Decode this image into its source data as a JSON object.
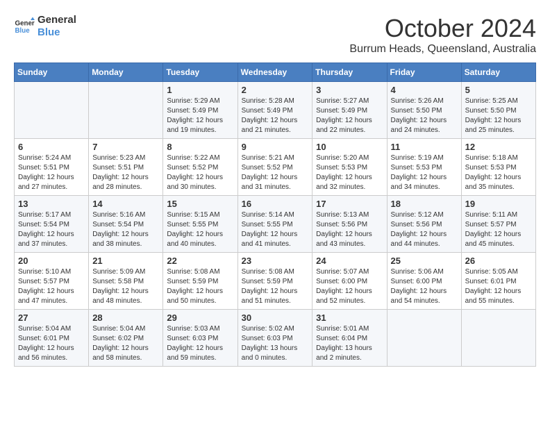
{
  "logo": {
    "line1": "General",
    "line2": "Blue"
  },
  "title": "October 2024",
  "location": "Burrum Heads, Queensland, Australia",
  "weekdays": [
    "Sunday",
    "Monday",
    "Tuesday",
    "Wednesday",
    "Thursday",
    "Friday",
    "Saturday"
  ],
  "weeks": [
    [
      {
        "day": "",
        "sunrise": "",
        "sunset": "",
        "daylight": ""
      },
      {
        "day": "",
        "sunrise": "",
        "sunset": "",
        "daylight": ""
      },
      {
        "day": "1",
        "sunrise": "Sunrise: 5:29 AM",
        "sunset": "Sunset: 5:49 PM",
        "daylight": "Daylight: 12 hours and 19 minutes."
      },
      {
        "day": "2",
        "sunrise": "Sunrise: 5:28 AM",
        "sunset": "Sunset: 5:49 PM",
        "daylight": "Daylight: 12 hours and 21 minutes."
      },
      {
        "day": "3",
        "sunrise": "Sunrise: 5:27 AM",
        "sunset": "Sunset: 5:49 PM",
        "daylight": "Daylight: 12 hours and 22 minutes."
      },
      {
        "day": "4",
        "sunrise": "Sunrise: 5:26 AM",
        "sunset": "Sunset: 5:50 PM",
        "daylight": "Daylight: 12 hours and 24 minutes."
      },
      {
        "day": "5",
        "sunrise": "Sunrise: 5:25 AM",
        "sunset": "Sunset: 5:50 PM",
        "daylight": "Daylight: 12 hours and 25 minutes."
      }
    ],
    [
      {
        "day": "6",
        "sunrise": "Sunrise: 5:24 AM",
        "sunset": "Sunset: 5:51 PM",
        "daylight": "Daylight: 12 hours and 27 minutes."
      },
      {
        "day": "7",
        "sunrise": "Sunrise: 5:23 AM",
        "sunset": "Sunset: 5:51 PM",
        "daylight": "Daylight: 12 hours and 28 minutes."
      },
      {
        "day": "8",
        "sunrise": "Sunrise: 5:22 AM",
        "sunset": "Sunset: 5:52 PM",
        "daylight": "Daylight: 12 hours and 30 minutes."
      },
      {
        "day": "9",
        "sunrise": "Sunrise: 5:21 AM",
        "sunset": "Sunset: 5:52 PM",
        "daylight": "Daylight: 12 hours and 31 minutes."
      },
      {
        "day": "10",
        "sunrise": "Sunrise: 5:20 AM",
        "sunset": "Sunset: 5:53 PM",
        "daylight": "Daylight: 12 hours and 32 minutes."
      },
      {
        "day": "11",
        "sunrise": "Sunrise: 5:19 AM",
        "sunset": "Sunset: 5:53 PM",
        "daylight": "Daylight: 12 hours and 34 minutes."
      },
      {
        "day": "12",
        "sunrise": "Sunrise: 5:18 AM",
        "sunset": "Sunset: 5:53 PM",
        "daylight": "Daylight: 12 hours and 35 minutes."
      }
    ],
    [
      {
        "day": "13",
        "sunrise": "Sunrise: 5:17 AM",
        "sunset": "Sunset: 5:54 PM",
        "daylight": "Daylight: 12 hours and 37 minutes."
      },
      {
        "day": "14",
        "sunrise": "Sunrise: 5:16 AM",
        "sunset": "Sunset: 5:54 PM",
        "daylight": "Daylight: 12 hours and 38 minutes."
      },
      {
        "day": "15",
        "sunrise": "Sunrise: 5:15 AM",
        "sunset": "Sunset: 5:55 PM",
        "daylight": "Daylight: 12 hours and 40 minutes."
      },
      {
        "day": "16",
        "sunrise": "Sunrise: 5:14 AM",
        "sunset": "Sunset: 5:55 PM",
        "daylight": "Daylight: 12 hours and 41 minutes."
      },
      {
        "day": "17",
        "sunrise": "Sunrise: 5:13 AM",
        "sunset": "Sunset: 5:56 PM",
        "daylight": "Daylight: 12 hours and 43 minutes."
      },
      {
        "day": "18",
        "sunrise": "Sunrise: 5:12 AM",
        "sunset": "Sunset: 5:56 PM",
        "daylight": "Daylight: 12 hours and 44 minutes."
      },
      {
        "day": "19",
        "sunrise": "Sunrise: 5:11 AM",
        "sunset": "Sunset: 5:57 PM",
        "daylight": "Daylight: 12 hours and 45 minutes."
      }
    ],
    [
      {
        "day": "20",
        "sunrise": "Sunrise: 5:10 AM",
        "sunset": "Sunset: 5:57 PM",
        "daylight": "Daylight: 12 hours and 47 minutes."
      },
      {
        "day": "21",
        "sunrise": "Sunrise: 5:09 AM",
        "sunset": "Sunset: 5:58 PM",
        "daylight": "Daylight: 12 hours and 48 minutes."
      },
      {
        "day": "22",
        "sunrise": "Sunrise: 5:08 AM",
        "sunset": "Sunset: 5:59 PM",
        "daylight": "Daylight: 12 hours and 50 minutes."
      },
      {
        "day": "23",
        "sunrise": "Sunrise: 5:08 AM",
        "sunset": "Sunset: 5:59 PM",
        "daylight": "Daylight: 12 hours and 51 minutes."
      },
      {
        "day": "24",
        "sunrise": "Sunrise: 5:07 AM",
        "sunset": "Sunset: 6:00 PM",
        "daylight": "Daylight: 12 hours and 52 minutes."
      },
      {
        "day": "25",
        "sunrise": "Sunrise: 5:06 AM",
        "sunset": "Sunset: 6:00 PM",
        "daylight": "Daylight: 12 hours and 54 minutes."
      },
      {
        "day": "26",
        "sunrise": "Sunrise: 5:05 AM",
        "sunset": "Sunset: 6:01 PM",
        "daylight": "Daylight: 12 hours and 55 minutes."
      }
    ],
    [
      {
        "day": "27",
        "sunrise": "Sunrise: 5:04 AM",
        "sunset": "Sunset: 6:01 PM",
        "daylight": "Daylight: 12 hours and 56 minutes."
      },
      {
        "day": "28",
        "sunrise": "Sunrise: 5:04 AM",
        "sunset": "Sunset: 6:02 PM",
        "daylight": "Daylight: 12 hours and 58 minutes."
      },
      {
        "day": "29",
        "sunrise": "Sunrise: 5:03 AM",
        "sunset": "Sunset: 6:03 PM",
        "daylight": "Daylight: 12 hours and 59 minutes."
      },
      {
        "day": "30",
        "sunrise": "Sunrise: 5:02 AM",
        "sunset": "Sunset: 6:03 PM",
        "daylight": "Daylight: 13 hours and 0 minutes."
      },
      {
        "day": "31",
        "sunrise": "Sunrise: 5:01 AM",
        "sunset": "Sunset: 6:04 PM",
        "daylight": "Daylight: 13 hours and 2 minutes."
      },
      {
        "day": "",
        "sunrise": "",
        "sunset": "",
        "daylight": ""
      },
      {
        "day": "",
        "sunrise": "",
        "sunset": "",
        "daylight": ""
      }
    ]
  ]
}
